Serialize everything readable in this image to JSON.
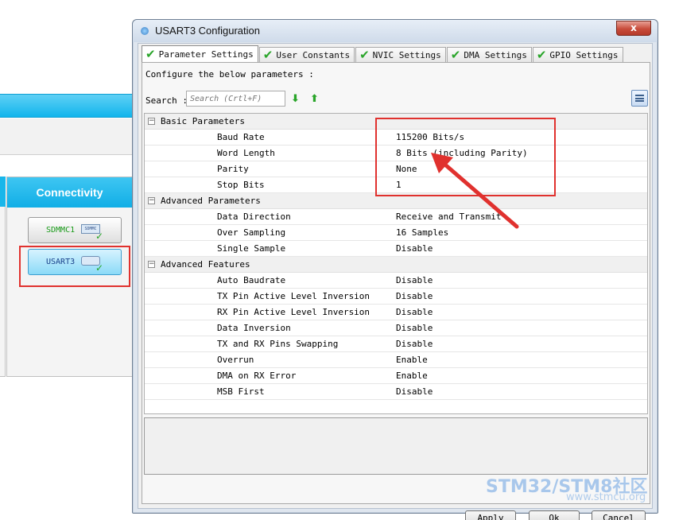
{
  "background_app": {
    "connectivity_header": "Connectivity",
    "peripherals": [
      {
        "label": "SDMMC1",
        "chip_label": "SDMMC",
        "state": "configured"
      },
      {
        "label": "USART3",
        "chip_label": "",
        "state": "selected"
      }
    ]
  },
  "dialog": {
    "title": "USART3 Configuration",
    "close_symbol": "x",
    "tabs": [
      {
        "label": "Parameter Settings",
        "active": true
      },
      {
        "label": "User Constants",
        "active": false
      },
      {
        "label": "NVIC Settings",
        "active": false
      },
      {
        "label": "DMA Settings",
        "active": false
      },
      {
        "label": "GPIO Settings",
        "active": false
      }
    ],
    "configure_text": "Configure the below parameters :",
    "search_label": "Search :",
    "search_placeholder": "Search (Crtl+F)",
    "groups": [
      {
        "name": "Basic Parameters",
        "params": [
          {
            "name": "Baud Rate",
            "value": "115200 Bits/s"
          },
          {
            "name": "Word Length",
            "value": "8 Bits (including Parity)"
          },
          {
            "name": "Parity",
            "value": "None"
          },
          {
            "name": "Stop Bits",
            "value": "1"
          }
        ]
      },
      {
        "name": "Advanced Parameters",
        "params": [
          {
            "name": "Data Direction",
            "value": "Receive and Transmit"
          },
          {
            "name": "Over Sampling",
            "value": "16 Samples"
          },
          {
            "name": "Single Sample",
            "value": "Disable"
          }
        ]
      },
      {
        "name": "Advanced Features",
        "params": [
          {
            "name": "Auto Baudrate",
            "value": "Disable"
          },
          {
            "name": "TX Pin Active Level Inversion",
            "value": "Disable"
          },
          {
            "name": "RX Pin Active Level Inversion",
            "value": "Disable"
          },
          {
            "name": "Data Inversion",
            "value": "Disable"
          },
          {
            "name": "TX and RX Pins Swapping",
            "value": "Disable"
          },
          {
            "name": "Overrun",
            "value": "Enable"
          },
          {
            "name": "DMA on RX Error",
            "value": "Enable"
          },
          {
            "name": "MSB First",
            "value": "Disable"
          }
        ]
      }
    ],
    "buttons": {
      "apply": "Apply",
      "ok": "Ok",
      "cancel": "Cancel"
    }
  },
  "watermark": {
    "text": "STM32/STM8社区",
    "sub": "www.stmcu.org"
  },
  "colors": {
    "accent_blue": "#11b5ec",
    "annotation_red": "#e0312e",
    "check_green": "#2aa52a"
  }
}
